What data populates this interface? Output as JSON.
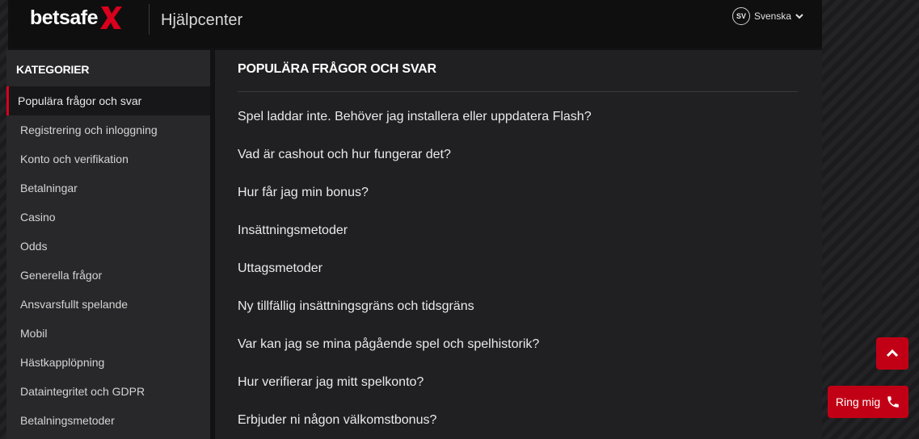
{
  "header": {
    "logo_text": "betsafe",
    "title": "Hjälpcenter",
    "language": {
      "code": "SV",
      "label": "Svenska"
    }
  },
  "sidebar": {
    "heading": "KATEGORIER",
    "items": [
      {
        "label": "Populära frågor och svar",
        "active": true
      },
      {
        "label": "Registrering och inloggning"
      },
      {
        "label": "Konto och verifikation"
      },
      {
        "label": "Betalningar"
      },
      {
        "label": "Casino"
      },
      {
        "label": "Odds"
      },
      {
        "label": "Generella frågor"
      },
      {
        "label": "Ansvarsfullt spelande"
      },
      {
        "label": "Mobil"
      },
      {
        "label": "Hästkapplöpning"
      },
      {
        "label": "Dataintegritet och GDPR"
      },
      {
        "label": "Betalningsmetoder"
      }
    ]
  },
  "main": {
    "title": "POPULÄRA FRÅGOR OCH SVAR",
    "questions": [
      "Spel laddar inte. Behöver jag installera eller uppdatera Flash?",
      "Vad är cashout och hur fungerar det?",
      "Hur får jag min bonus?",
      "Insättningsmetoder",
      "Uttagsmetoder",
      "Ny tillfällig insättningsgräns och tidsgräns",
      "Var kan jag se mina pågående spel och spelhistorik?",
      "Hur verifierar jag mitt spelkonto?",
      "Erbjuder ni någon välkomstbonus?"
    ]
  },
  "floating": {
    "call_label": "Ring mig",
    "scroll_top_icon": "chevron-up-icon",
    "call_icon": "phone-icon"
  },
  "colors": {
    "accent": "#c20015",
    "header_bg": "#0f0f10",
    "sidebar_bg": "#28282a",
    "content_bg": "#202022"
  }
}
